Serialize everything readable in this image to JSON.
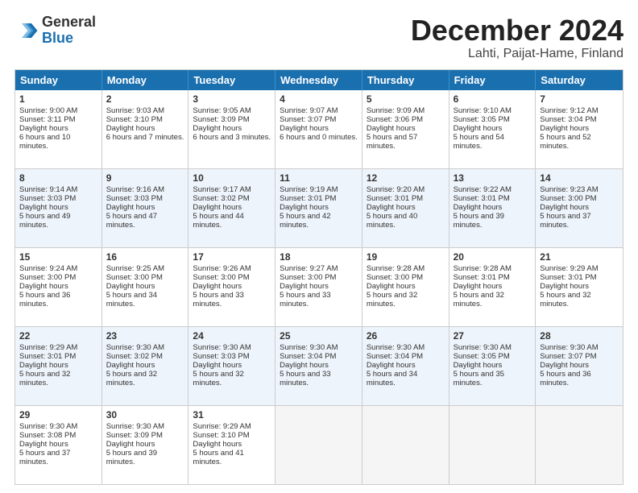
{
  "logo": {
    "general": "General",
    "blue": "Blue"
  },
  "header": {
    "title": "December 2024",
    "subtitle": "Lahti, Paijat-Hame, Finland"
  },
  "weekdays": [
    "Sunday",
    "Monday",
    "Tuesday",
    "Wednesday",
    "Thursday",
    "Friday",
    "Saturday"
  ],
  "weeks": [
    [
      {
        "day": 1,
        "sunrise": "9:00 AM",
        "sunset": "3:11 PM",
        "daylight": "6 hours and 10 minutes."
      },
      {
        "day": 2,
        "sunrise": "9:03 AM",
        "sunset": "3:10 PM",
        "daylight": "6 hours and 7 minutes."
      },
      {
        "day": 3,
        "sunrise": "9:05 AM",
        "sunset": "3:09 PM",
        "daylight": "6 hours and 3 minutes."
      },
      {
        "day": 4,
        "sunrise": "9:07 AM",
        "sunset": "3:07 PM",
        "daylight": "6 hours and 0 minutes."
      },
      {
        "day": 5,
        "sunrise": "9:09 AM",
        "sunset": "3:06 PM",
        "daylight": "5 hours and 57 minutes."
      },
      {
        "day": 6,
        "sunrise": "9:10 AM",
        "sunset": "3:05 PM",
        "daylight": "5 hours and 54 minutes."
      },
      {
        "day": 7,
        "sunrise": "9:12 AM",
        "sunset": "3:04 PM",
        "daylight": "5 hours and 52 minutes."
      }
    ],
    [
      {
        "day": 8,
        "sunrise": "9:14 AM",
        "sunset": "3:03 PM",
        "daylight": "5 hours and 49 minutes."
      },
      {
        "day": 9,
        "sunrise": "9:16 AM",
        "sunset": "3:03 PM",
        "daylight": "5 hours and 47 minutes."
      },
      {
        "day": 10,
        "sunrise": "9:17 AM",
        "sunset": "3:02 PM",
        "daylight": "5 hours and 44 minutes."
      },
      {
        "day": 11,
        "sunrise": "9:19 AM",
        "sunset": "3:01 PM",
        "daylight": "5 hours and 42 minutes."
      },
      {
        "day": 12,
        "sunrise": "9:20 AM",
        "sunset": "3:01 PM",
        "daylight": "5 hours and 40 minutes."
      },
      {
        "day": 13,
        "sunrise": "9:22 AM",
        "sunset": "3:01 PM",
        "daylight": "5 hours and 39 minutes."
      },
      {
        "day": 14,
        "sunrise": "9:23 AM",
        "sunset": "3:00 PM",
        "daylight": "5 hours and 37 minutes."
      }
    ],
    [
      {
        "day": 15,
        "sunrise": "9:24 AM",
        "sunset": "3:00 PM",
        "daylight": "5 hours and 36 minutes."
      },
      {
        "day": 16,
        "sunrise": "9:25 AM",
        "sunset": "3:00 PM",
        "daylight": "5 hours and 34 minutes."
      },
      {
        "day": 17,
        "sunrise": "9:26 AM",
        "sunset": "3:00 PM",
        "daylight": "5 hours and 33 minutes."
      },
      {
        "day": 18,
        "sunrise": "9:27 AM",
        "sunset": "3:00 PM",
        "daylight": "5 hours and 33 minutes."
      },
      {
        "day": 19,
        "sunrise": "9:28 AM",
        "sunset": "3:00 PM",
        "daylight": "5 hours and 32 minutes."
      },
      {
        "day": 20,
        "sunrise": "9:28 AM",
        "sunset": "3:01 PM",
        "daylight": "5 hours and 32 minutes."
      },
      {
        "day": 21,
        "sunrise": "9:29 AM",
        "sunset": "3:01 PM",
        "daylight": "5 hours and 32 minutes."
      }
    ],
    [
      {
        "day": 22,
        "sunrise": "9:29 AM",
        "sunset": "3:01 PM",
        "daylight": "5 hours and 32 minutes."
      },
      {
        "day": 23,
        "sunrise": "9:30 AM",
        "sunset": "3:02 PM",
        "daylight": "5 hours and 32 minutes."
      },
      {
        "day": 24,
        "sunrise": "9:30 AM",
        "sunset": "3:03 PM",
        "daylight": "5 hours and 32 minutes."
      },
      {
        "day": 25,
        "sunrise": "9:30 AM",
        "sunset": "3:04 PM",
        "daylight": "5 hours and 33 minutes."
      },
      {
        "day": 26,
        "sunrise": "9:30 AM",
        "sunset": "3:04 PM",
        "daylight": "5 hours and 34 minutes."
      },
      {
        "day": 27,
        "sunrise": "9:30 AM",
        "sunset": "3:05 PM",
        "daylight": "5 hours and 35 minutes."
      },
      {
        "day": 28,
        "sunrise": "9:30 AM",
        "sunset": "3:07 PM",
        "daylight": "5 hours and 36 minutes."
      }
    ],
    [
      {
        "day": 29,
        "sunrise": "9:30 AM",
        "sunset": "3:08 PM",
        "daylight": "5 hours and 37 minutes."
      },
      {
        "day": 30,
        "sunrise": "9:30 AM",
        "sunset": "3:09 PM",
        "daylight": "5 hours and 39 minutes."
      },
      {
        "day": 31,
        "sunrise": "9:29 AM",
        "sunset": "3:10 PM",
        "daylight": "5 hours and 41 minutes."
      },
      null,
      null,
      null,
      null
    ]
  ]
}
